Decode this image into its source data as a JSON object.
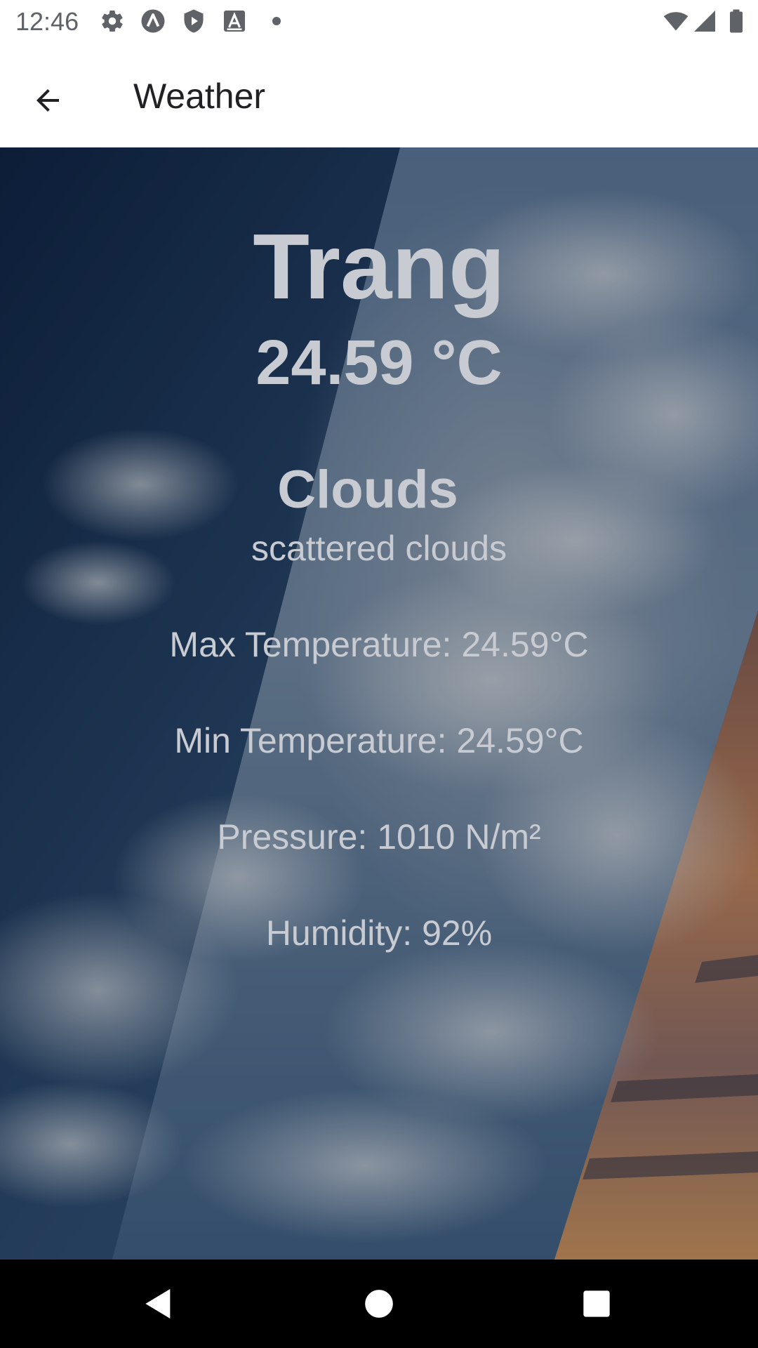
{
  "status_bar": {
    "time": "12:46",
    "icons_left": [
      "settings-icon",
      "app-a-icon",
      "shield-play-icon",
      "font-a-icon",
      "dot-icon"
    ],
    "icons_right": [
      "wifi-icon",
      "cellular-signal-icon",
      "battery-icon"
    ],
    "color": "#5f6368"
  },
  "app_bar": {
    "title": "Weather",
    "back_icon": "arrow-back-icon"
  },
  "weather": {
    "city": "Trang",
    "temperature": "24.59 °C",
    "condition": "Clouds",
    "description": "scattered clouds",
    "max_temperature": "Max Temperature: 24.59°C",
    "min_temperature": "Min Temperature: 24.59°C",
    "pressure": "Pressure: 1010 N/m²",
    "humidity": "Humidity: 92%"
  },
  "colors": {
    "text": "#c8ccd2",
    "sky_dark": "#1f3550",
    "sky_mid": "#4d6a8a",
    "sunset": "#c9835a"
  },
  "nav_bar": {
    "buttons": [
      "back-triangle-icon",
      "home-circle-icon",
      "recents-square-icon"
    ]
  }
}
